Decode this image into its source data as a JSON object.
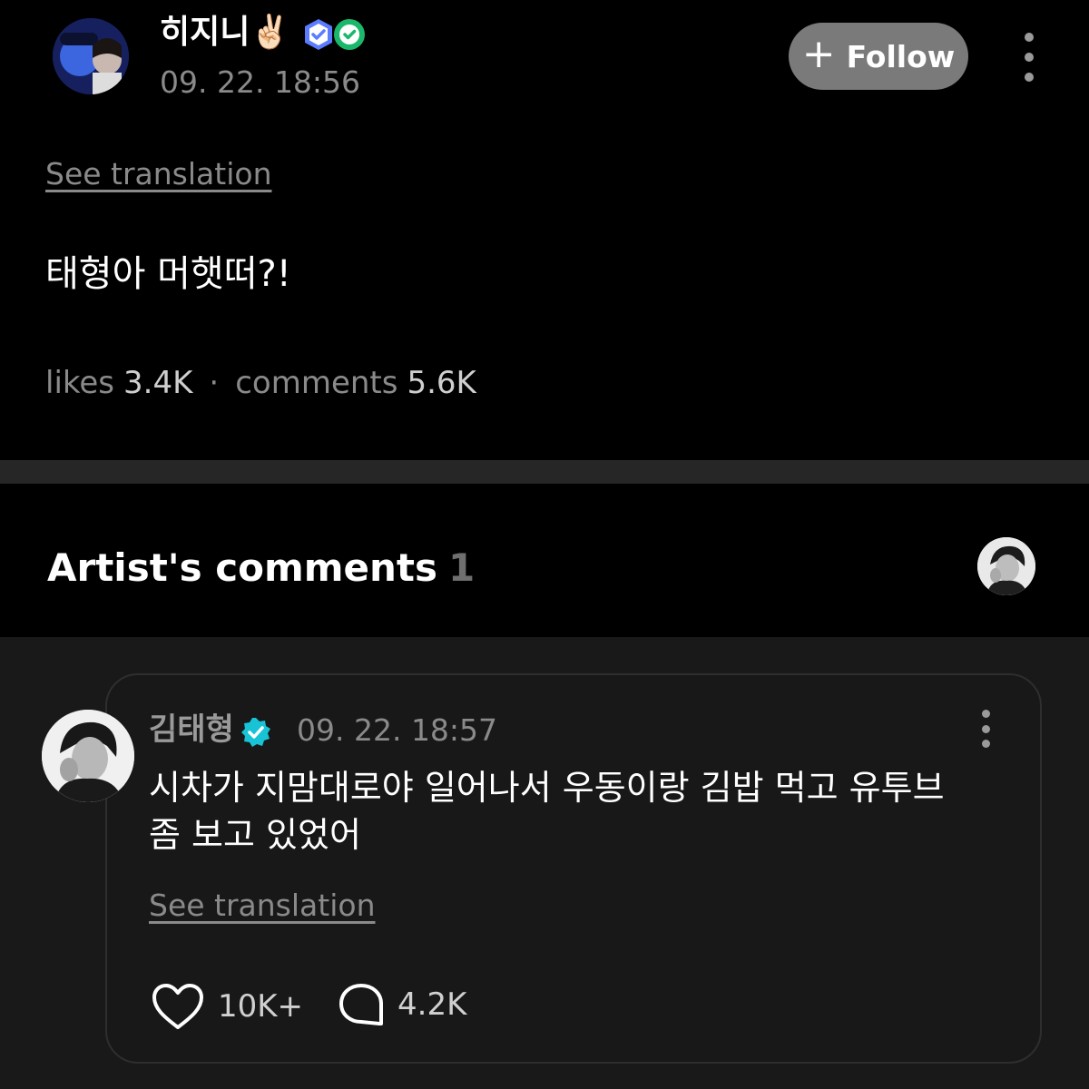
{
  "post": {
    "author": {
      "name": "히지니✌🏻",
      "badges": [
        "membership-badge-icon",
        "fan-badge-icon"
      ]
    },
    "timestamp": "09. 22. 18:56",
    "follow_label": "Follow",
    "see_translation": "See translation",
    "text": "태형아 머햇떠?!",
    "stats": {
      "likes_label": "likes",
      "likes_value": "3.4K",
      "separator": "·",
      "comments_label": "comments",
      "comments_value": "5.6K"
    }
  },
  "artist_comments": {
    "title": "Artist's comments",
    "count": "1",
    "comment": {
      "author": "김태형",
      "timestamp": "09. 22. 18:57",
      "text_line1": "시차가 지맘대로야 일어나서 우동이랑 김밥 먹고 유투브",
      "text_line2": "좀 보고 있었어",
      "see_translation": "See translation",
      "likes": "10K+",
      "replies": "4.2K"
    }
  },
  "colors": {
    "background": "#000000",
    "comment_area": "#191919",
    "follow_button": "#7a7a7a",
    "verified": "#19c3d6",
    "muted_text": "#8a8a8a"
  }
}
